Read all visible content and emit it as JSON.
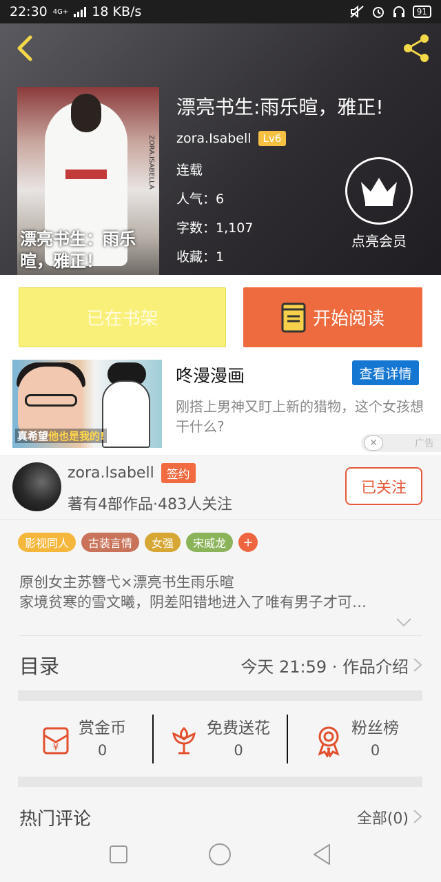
{
  "status_bar": {
    "time": "22:30",
    "network": "4G+",
    "speed": "18 KB/s",
    "battery": "91"
  },
  "book": {
    "title": "漂亮书生:雨乐暄，雅正!",
    "cover_title": "漂亮书生：雨乐暄，雅正！",
    "cover_side_text": "ZORA.ISABELLA",
    "author": "zora.Isabell",
    "level": "Lv6",
    "status": "连载",
    "popularity": "人气：6",
    "word_count": "字数：1,107",
    "favorites": "收藏：1",
    "vip_label": "点亮会员"
  },
  "actions": {
    "shelf_label": "已在书架",
    "read_label": "开始阅读"
  },
  "ad": {
    "title": "咚漫漫画",
    "detail_label": "查看详情",
    "description": "刚搭上男神又盯上新的猎物，这个女孩想干什么?",
    "caption_a": "真希望",
    "caption_b": "他也是我的!",
    "tag": "广告"
  },
  "author_card": {
    "name": "zora.Isabell",
    "badge": "签约",
    "stats": "著有4部作品·483人关注",
    "follow_label": "已关注"
  },
  "tags": [
    {
      "label": "影视同人",
      "color": "#f5b63c"
    },
    {
      "label": "古装言情",
      "color": "#c9735a"
    },
    {
      "label": "女强",
      "color": "#d6a734"
    },
    {
      "label": "宋威龙",
      "color": "#8bb35a"
    }
  ],
  "tag_more": "+",
  "summary": {
    "line1": "原创女主苏簪弋×漂亮书生雨乐暄",
    "line2": "家境贫寒的雪文曦，阴差阳错地进入了唯有男子才可…"
  },
  "toc": {
    "label": "目录",
    "right": "今天 21:59 · 作品介绍"
  },
  "rewards": [
    {
      "label": "赏金币",
      "count": "0"
    },
    {
      "label": "免费送花",
      "count": "0"
    },
    {
      "label": "粉丝榜",
      "count": "0"
    }
  ],
  "comments": {
    "label": "热门评论",
    "all": "全部(0)"
  },
  "colors": {
    "accent": "#ee6a3f",
    "shelf_yellow": "#f9f07a",
    "link_blue": "#1677d2",
    "level_gold": "#f6c142"
  }
}
